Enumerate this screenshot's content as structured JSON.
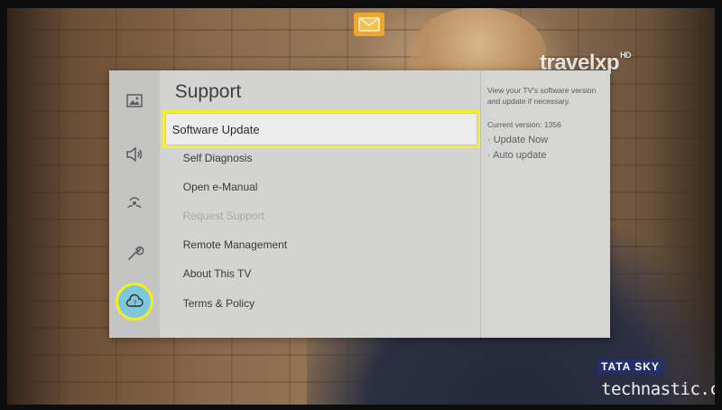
{
  "background": {
    "brand_logo": "travelxp",
    "brand_logo_sup": "HD",
    "channel_logo": "TATA SKY",
    "watermark": "technastic.com",
    "notification_icon": "mail-icon"
  },
  "sidebar": {
    "items": [
      {
        "icon": "picture-icon",
        "selected": false
      },
      {
        "icon": "sound-icon",
        "selected": false
      },
      {
        "icon": "broadcasting-icon",
        "selected": false
      },
      {
        "icon": "general-wrench-icon",
        "selected": false
      },
      {
        "icon": "support-cloud-icon",
        "selected": true
      }
    ],
    "accent_color": "#f2ee20",
    "active_bg": "#7fc8dc"
  },
  "menu": {
    "title": "Support",
    "items": [
      {
        "label": "Software Update",
        "state": "selected"
      },
      {
        "label": "Self Diagnosis",
        "state": "normal"
      },
      {
        "label": "Open e-Manual",
        "state": "normal"
      },
      {
        "label": "Request Support",
        "state": "disabled"
      },
      {
        "label": "Remote Management",
        "state": "normal"
      },
      {
        "label": "About This TV",
        "state": "normal"
      },
      {
        "label": "Terms & Policy",
        "state": "normal"
      }
    ]
  },
  "info_panel": {
    "description": "View your TV's software version and update if necessary.",
    "current_version": "Current version: 1356",
    "options": [
      "· Update Now",
      "· Auto update"
    ]
  }
}
